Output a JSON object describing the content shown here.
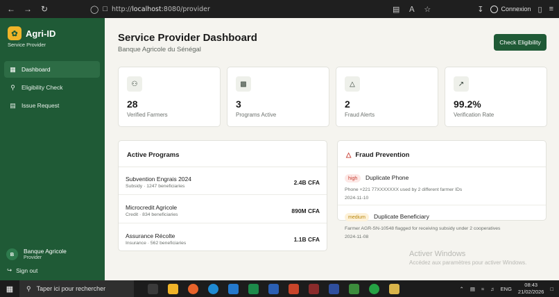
{
  "browser": {
    "url_prefix": "http://",
    "url_host": "localhost",
    "url_rest": ":8080/provider",
    "connexion": "Connexion"
  },
  "sidebar": {
    "app_name": "Agri-ID",
    "role": "Service Provider",
    "nav": [
      {
        "label": "Dashboard",
        "icon": "grid-icon",
        "active": true
      },
      {
        "label": "Eligibility Check",
        "icon": "search-icon",
        "active": false
      },
      {
        "label": "Issue Request",
        "icon": "document-icon",
        "active": false
      }
    ],
    "user": {
      "initial": "B",
      "name": "Banque Agricole",
      "role": "Provider"
    },
    "signout": "Sign out"
  },
  "header": {
    "title": "Service Provider Dashboard",
    "subtitle": "Banque Agricole du Sénégal",
    "check_button": "Check Eligibility"
  },
  "stats": [
    {
      "value": "28",
      "label": "Verified Farmers",
      "icon": "users-icon"
    },
    {
      "value": "3",
      "label": "Programs Active",
      "icon": "bar-chart-icon"
    },
    {
      "value": "2",
      "label": "Fraud Alerts",
      "icon": "alert-triangle-icon"
    },
    {
      "value": "99.2%",
      "label": "Verification Rate",
      "icon": "trending-up-icon"
    }
  ],
  "programs": {
    "title": "Active Programs",
    "items": [
      {
        "name": "Subvention Engrais 2024",
        "meta": "Subsidy · 1247 beneficiaries",
        "amount": "2.4B CFA"
      },
      {
        "name": "Microcredit Agricole",
        "meta": "Credit · 834 beneficiaries",
        "amount": "890M CFA"
      },
      {
        "name": "Assurance Récolte",
        "meta": "Insurance · 562 beneficiaries",
        "amount": "1.1B CFA"
      }
    ]
  },
  "fraud": {
    "title": "Fraud Prevention",
    "items": [
      {
        "severity": "high",
        "title": "Duplicate Phone",
        "desc": "Phone +221 77XXXXXXX used by 2 different farmer IDs",
        "date": "2024-11-10"
      },
      {
        "severity": "medium",
        "title": "Duplicate Beneficiary",
        "desc": "Farmer AGR-SN-10548 flagged for receiving subsidy under 2 cooperatives",
        "date": "2024-11-08"
      }
    ]
  },
  "watermark": {
    "line1": "Activer Windows",
    "line2": "Accédez aux paramètres pour activer Windows."
  },
  "taskbar": {
    "search_placeholder": "Taper ici pour rechercher",
    "lang": "ENG",
    "time": "08:43",
    "date": "21/02/2026"
  },
  "colors": {
    "sidebar": "#1f5a36",
    "accent": "#f0b429",
    "high": "#c6392d",
    "medium": "#b8860b"
  }
}
